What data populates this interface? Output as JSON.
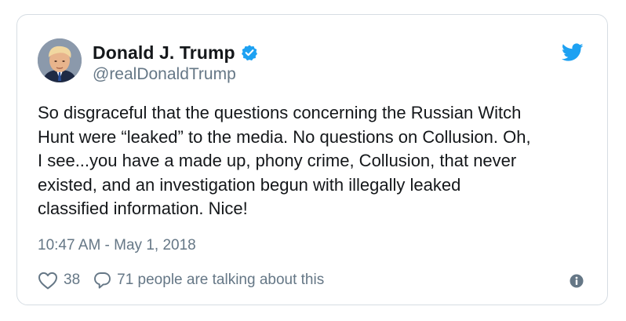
{
  "tweet": {
    "display_name": "Donald J. Trump",
    "handle": "@realDonaldTrump",
    "verified_icon": "verified-badge-icon",
    "text": "So disgraceful that the questions concerning the Russian Witch\nHunt were “leaked” to the media. No questions on Collusion. Oh,\nI see...you have a made up, phony crime, Collusion, that never\nexisted, and an investigation begun with illegally leaked\nclassified information. Nice!",
    "timestamp": "10:47 AM - May 1, 2018",
    "likes": "38",
    "talking": "71 people are talking about this"
  },
  "icons": {
    "brand": "twitter-bird-icon",
    "like": "heart-icon",
    "reply": "speech-bubble-icon",
    "info": "info-icon"
  },
  "colors": {
    "brand_blue": "#1da1f2",
    "text": "#14171a",
    "secondary": "#657786",
    "border": "#d6dde3"
  }
}
